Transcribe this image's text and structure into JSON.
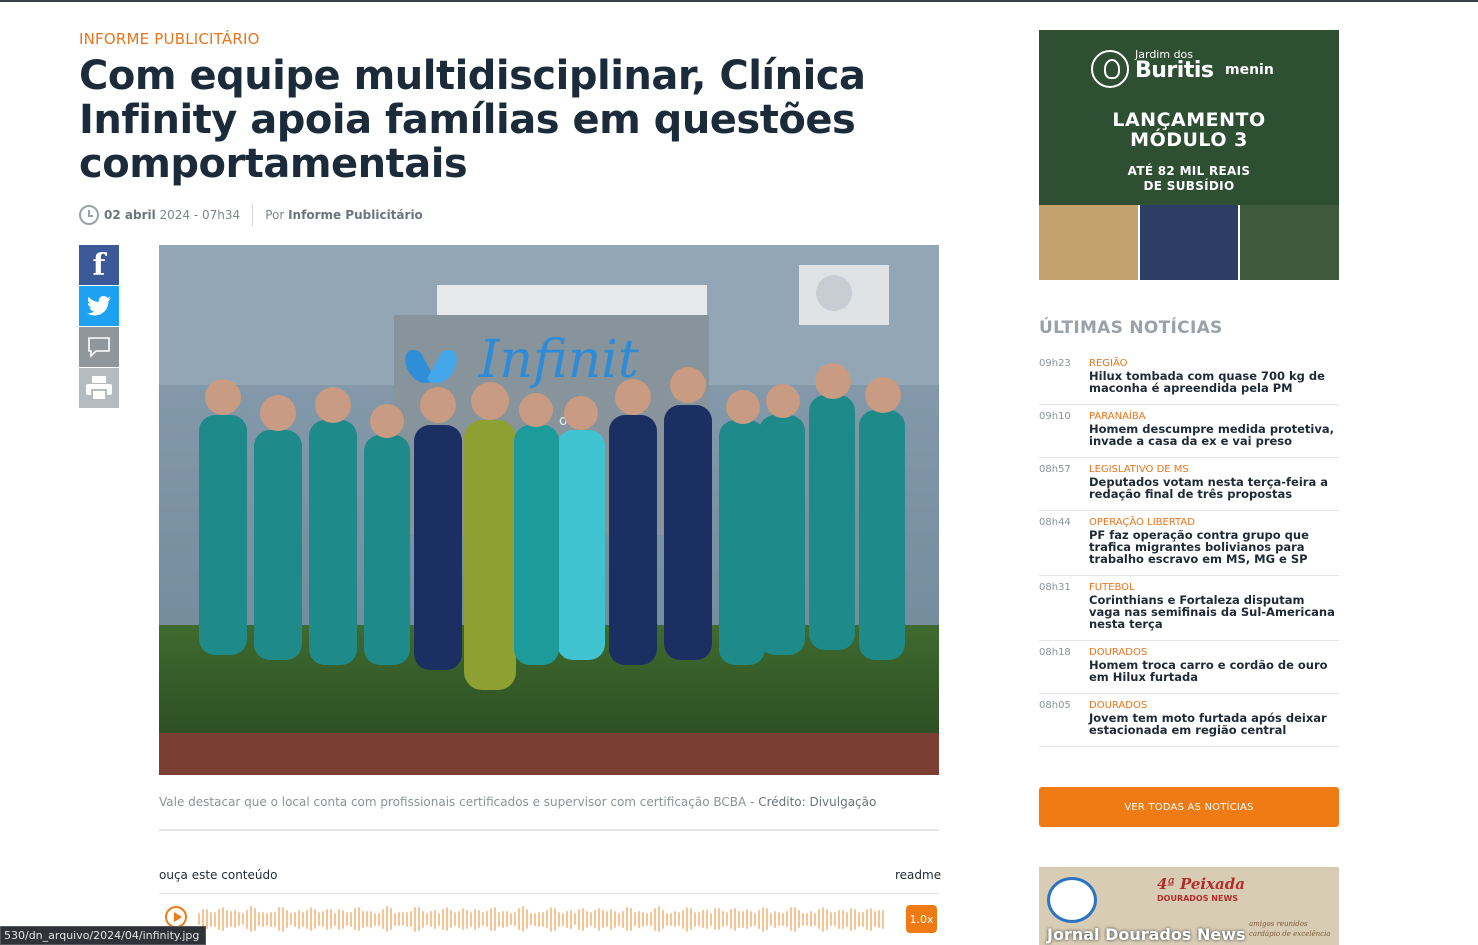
{
  "article": {
    "kicker": "INFORME PUBLICITÁRIO",
    "headline": "Com equipe multidisciplinar, Clínica Infinity apoia famílias em questões comportamentais",
    "date_bold": "02 abril",
    "date_rest": " 2024 - 07h34",
    "by_label": "Por ",
    "author": "Informe Publicitário",
    "caption": "Vale destacar que o local conta com profissionais certificados e supervisor com certificação BCBA - ",
    "credit": "Crédito: Divulgação",
    "photo_sign_text": "Infinit",
    "photo_sign_sub": "oc"
  },
  "share": {
    "facebook_icon": "facebook-icon",
    "twitter_icon": "twitter-icon",
    "comment_icon": "comment-icon",
    "print_icon": "print-icon"
  },
  "player": {
    "label": "ouça este conteúdo",
    "readme": "readme",
    "speed": "1.0x"
  },
  "status_bar": "530/dn_arquivo/2024/04/infinity.jpg",
  "ad_top": {
    "brand_small": "Jardim dos",
    "brand_big": "Buritis",
    "partner": "menin",
    "headline_l1": "LANÇAMENTO",
    "headline_l2": "MÓDULO 3",
    "sub_l1": "ATÉ 82 MIL REAIS",
    "sub_l2": "DE SUBSÍDIO"
  },
  "latest": {
    "title": "ÚLTIMAS NOTÍCIAS",
    "items": [
      {
        "time": "09h23",
        "category": "REGIÃO",
        "text": "Hilux tombada com quase 700 kg de maconha é apreendida pela PM"
      },
      {
        "time": "09h10",
        "category": "PARANAÍBA",
        "text": "Homem descumpre medida protetiva, invade a casa da ex e vai preso"
      },
      {
        "time": "08h57",
        "category": "LEGISLATIVO DE MS",
        "text": "Deputados votam nesta terça-feira a redação final de três propostas"
      },
      {
        "time": "08h44",
        "category": "OPERAÇÃO LIBERTAD",
        "text": "PF faz operação contra grupo que trafica migrantes bolivianos para trabalho escravo em MS, MG e SP"
      },
      {
        "time": "08h31",
        "category": "FUTEBOL",
        "text": "Corinthians e Fortaleza disputam vaga nas semifinais da Sul-Americana nesta terça"
      },
      {
        "time": "08h18",
        "category": "DOURADOS",
        "text": "Homem troca carro e cordão de ouro em Hilux furtada"
      },
      {
        "time": "08h05",
        "category": "DOURADOS",
        "text": "Jovem tem moto furtada após deixar estacionada em região central"
      }
    ],
    "all_button": "VER TODAS AS NOTÍCIAS"
  },
  "ad_bottom": {
    "title": "4ª Peixada",
    "sub": "DOURADOS NEWS",
    "footer": "Jornal Dourados News",
    "tagline": "amigos reunidos cardápio de excelência"
  },
  "colors": {
    "accent": "#f07a13",
    "headline": "#1c2b3a",
    "ad_green": "#2f4f33"
  }
}
